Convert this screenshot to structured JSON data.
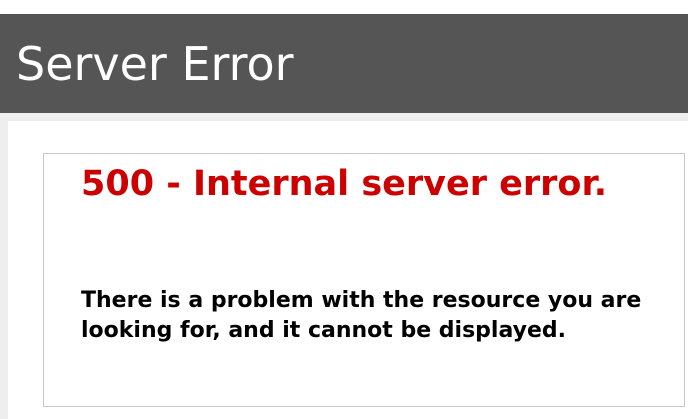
{
  "header": {
    "title": "Server Error"
  },
  "error": {
    "heading": "500 - Internal server error.",
    "message": "There is a problem with the resource you are looking for, and it cannot be displayed."
  },
  "colors": {
    "header_bg": "#555555",
    "header_text": "#ffffff",
    "heading_red": "#cc0000",
    "page_bg": "#eeeeee"
  }
}
